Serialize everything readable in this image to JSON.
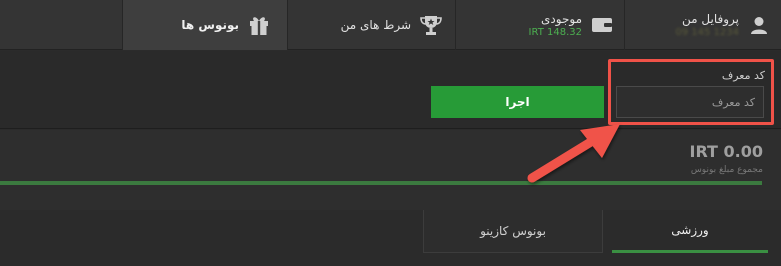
{
  "nav": {
    "profile": {
      "label": "پروفایل من",
      "subtitle": "09 145 1234"
    },
    "balance": {
      "label": "موجودی",
      "amount": "IRT 148.32"
    },
    "bets": {
      "label": "شرط های من"
    },
    "bonuses": {
      "label": "بونوس ها"
    }
  },
  "referral": {
    "label": "کد معرف",
    "placeholder": "کد معرف",
    "apply_label": "اجرا"
  },
  "bonus_total": {
    "amount": "IRT 0.00",
    "caption": "مجموع مبلغ بونوس",
    "progress_fraction": 1.0
  },
  "bonus_tabs": [
    {
      "label": "ورزشی",
      "active": true
    },
    {
      "label": "بونوس کازینو",
      "active": false
    }
  ],
  "colors": {
    "accent_green": "#279b37",
    "annotation_red": "#f05248"
  }
}
